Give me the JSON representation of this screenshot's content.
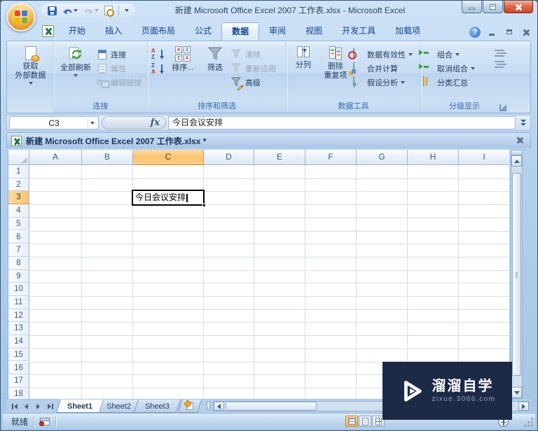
{
  "window": {
    "title": "新建 Microsoft Office Excel 2007 工作表.xlsx - Microsoft Excel"
  },
  "ribbon_tabs": [
    {
      "label": "开始",
      "active": false
    },
    {
      "label": "插入",
      "active": false
    },
    {
      "label": "页面布局",
      "active": false
    },
    {
      "label": "公式",
      "active": false
    },
    {
      "label": "数据",
      "active": true
    },
    {
      "label": "审阅",
      "active": false
    },
    {
      "label": "视图",
      "active": false
    },
    {
      "label": "开发工具",
      "active": false
    },
    {
      "label": "加载项",
      "active": false
    }
  ],
  "ribbon": {
    "get_external": "获取\n外部数据",
    "refresh_all": "全部刷新",
    "connections": "连接",
    "properties": "属性",
    "edit_links": "编辑链接",
    "sort": "排序...",
    "filter": "筛选",
    "clear": "清除",
    "reapply": "重新应用",
    "advanced": "高级",
    "text_to_columns": "分列",
    "remove_duplicates": "删除\n重复项",
    "data_validation": "数据有效性",
    "consolidate": "合并计算",
    "what_if": "假设分析",
    "group": "组合",
    "ungroup": "取消组合",
    "subtotal": "分类汇总",
    "labels": {
      "connections": "连接",
      "sort_filter": "排序和筛选",
      "data_tools": "数据工具",
      "outline": "分级显示"
    }
  },
  "formula_bar": {
    "name_box": "C3",
    "fx": "fx",
    "content": "今日会议安排"
  },
  "doc_window": {
    "title": "新建 Microsoft Office Excel 2007 工作表.xlsx *"
  },
  "grid": {
    "columns": [
      "A",
      "B",
      "C",
      "D",
      "E",
      "F",
      "G",
      "H",
      "I"
    ],
    "row_count": 18,
    "active_cell": {
      "ref": "C3",
      "value": "今日会议安排",
      "row": 3,
      "col_index": 2
    }
  },
  "sheet_tabs": [
    {
      "label": "Sheet1",
      "active": true
    },
    {
      "label": "Sheet2",
      "active": false
    },
    {
      "label": "Sheet3",
      "active": false
    }
  ],
  "status_bar": {
    "ready": "就绪"
  },
  "watermark": {
    "brand": "溜溜自学",
    "site": "zixue.3066.com"
  }
}
